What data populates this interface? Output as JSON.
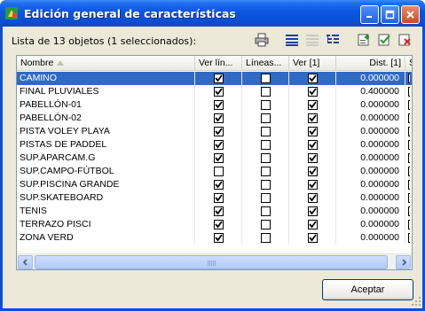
{
  "window": {
    "title": "Edición general de características",
    "accent": "#0a50d8"
  },
  "info": {
    "label": "Lista de 13 objetos (1 seleccionados):"
  },
  "toolbar": {
    "icons": [
      "print-icon",
      "list-view-icon",
      "details-view-icon",
      "tree-view-icon",
      "add-icon",
      "check-icon",
      "delete-icon"
    ]
  },
  "grid": {
    "columns": [
      {
        "key": "name",
        "label": "Nombre"
      },
      {
        "key": "ver_lin",
        "label": "Ver lín..."
      },
      {
        "key": "lineas",
        "label": "Líneas..."
      },
      {
        "key": "ver1",
        "label": "Ver [1]"
      },
      {
        "key": "dist1",
        "label": "Dist. [1]"
      },
      {
        "key": "s",
        "label": "S"
      }
    ],
    "rows": [
      {
        "name": "CAMINO",
        "ver_lin": true,
        "lineas": false,
        "ver1": true,
        "dist1": "0.000000",
        "selected": true
      },
      {
        "name": "FINAL PLUVIALES",
        "ver_lin": true,
        "lineas": false,
        "ver1": true,
        "dist1": "0.400000"
      },
      {
        "name": "PABELLÓN-01",
        "ver_lin": true,
        "lineas": false,
        "ver1": true,
        "dist1": "0.000000"
      },
      {
        "name": "PABELLÓN-02",
        "ver_lin": true,
        "lineas": false,
        "ver1": true,
        "dist1": "0.000000"
      },
      {
        "name": "PISTA VOLEY PLAYA",
        "ver_lin": true,
        "lineas": false,
        "ver1": true,
        "dist1": "0.000000"
      },
      {
        "name": "PISTAS DE PADDEL",
        "ver_lin": true,
        "lineas": false,
        "ver1": true,
        "dist1": "0.000000"
      },
      {
        "name": "SUP.APARCAM.G",
        "ver_lin": true,
        "lineas": false,
        "ver1": true,
        "dist1": "0.000000"
      },
      {
        "name": "SUP.CAMPO-FÚTBOL",
        "ver_lin": false,
        "lineas": false,
        "ver1": true,
        "dist1": "0.000000"
      },
      {
        "name": "SUP.PISCINA GRANDE",
        "ver_lin": true,
        "lineas": false,
        "ver1": true,
        "dist1": "0.000000"
      },
      {
        "name": "SUP.SKATEBOARD",
        "ver_lin": true,
        "lineas": false,
        "ver1": true,
        "dist1": "0.000000"
      },
      {
        "name": "TENIS",
        "ver_lin": true,
        "lineas": false,
        "ver1": true,
        "dist1": "0.000000"
      },
      {
        "name": "TERRAZO PISCI",
        "ver_lin": true,
        "lineas": false,
        "ver1": true,
        "dist1": "0.000000"
      },
      {
        "name": "ZONA VERD",
        "ver_lin": true,
        "lineas": false,
        "ver1": true,
        "dist1": "0.000000"
      }
    ]
  },
  "buttons": {
    "accept": "Aceptar"
  },
  "colors": {
    "selection": "#316ac5",
    "face": "#ece9d8"
  }
}
